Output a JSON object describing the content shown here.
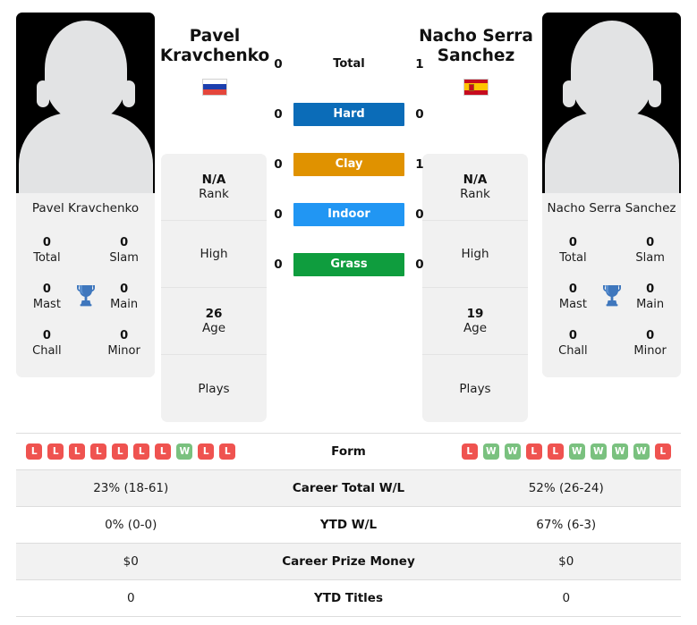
{
  "players": {
    "left": {
      "first_name": "Pavel",
      "last_name": "Kravchenko",
      "full_name": "Pavel Kravchenko",
      "country_flag": "russia-flag",
      "photo": "player-silhouette-placeholder",
      "titles": {
        "total_value": "0",
        "total_label": "Total",
        "slam_value": "0",
        "slam_label": "Slam",
        "mast_value": "0",
        "mast_label": "Mast",
        "main_value": "0",
        "main_label": "Main",
        "chall_value": "0",
        "chall_label": "Chall",
        "minor_value": "0",
        "minor_label": "Minor",
        "trophy_icon": "trophy-icon"
      },
      "info": {
        "rank_value": "N/A",
        "rank_label": "Rank",
        "high_value": "",
        "high_label": "High",
        "age_value": "26",
        "age_label": "Age",
        "plays_value": "",
        "plays_label": "Plays"
      },
      "form": [
        "L",
        "L",
        "L",
        "L",
        "L",
        "L",
        "L",
        "W",
        "L",
        "L"
      ],
      "career_total_wl": "23% (18-61)",
      "ytd_wl": "0% (0-0)",
      "career_prize_money": "$0",
      "ytd_titles": "0"
    },
    "right": {
      "first_name": "Nacho Serra",
      "last_name": "Sanchez",
      "full_name": "Nacho Serra Sanchez",
      "country_flag": "spain-flag",
      "photo": "player-silhouette-placeholder",
      "titles": {
        "total_value": "0",
        "total_label": "Total",
        "slam_value": "0",
        "slam_label": "Slam",
        "mast_value": "0",
        "mast_label": "Mast",
        "main_value": "0",
        "main_label": "Main",
        "chall_value": "0",
        "chall_label": "Chall",
        "minor_value": "0",
        "minor_label": "Minor",
        "trophy_icon": "trophy-icon"
      },
      "info": {
        "rank_value": "N/A",
        "rank_label": "Rank",
        "high_value": "",
        "high_label": "High",
        "age_value": "19",
        "age_label": "Age",
        "plays_value": "",
        "plays_label": "Plays"
      },
      "form": [
        "L",
        "W",
        "W",
        "L",
        "L",
        "W",
        "W",
        "W",
        "W",
        "L"
      ],
      "career_total_wl": "52% (26-24)",
      "ytd_wl": "67% (6-3)",
      "career_prize_money": "$0",
      "ytd_titles": "0"
    }
  },
  "head_to_head": [
    {
      "surface": "Total",
      "left_score": "0",
      "right_score": "1",
      "color": "transparent",
      "plain": true
    },
    {
      "surface": "Hard",
      "left_score": "0",
      "right_score": "0",
      "color": "#0b6cb8",
      "plain": false
    },
    {
      "surface": "Clay",
      "left_score": "0",
      "right_score": "1",
      "color": "#e09200",
      "plain": false
    },
    {
      "surface": "Indoor",
      "left_score": "0",
      "right_score": "0",
      "color": "#2196f3",
      "plain": false
    },
    {
      "surface": "Grass",
      "left_score": "0",
      "right_score": "0",
      "color": "#0f9d3e",
      "plain": false
    }
  ],
  "stats_rows": [
    {
      "label": "Form",
      "type": "form"
    },
    {
      "label": "Career Total W/L",
      "type": "text",
      "left": "23% (18-61)",
      "right": "52% (26-24)"
    },
    {
      "label": "YTD W/L",
      "type": "text",
      "left": "0% (0-0)",
      "right": "67% (6-3)"
    },
    {
      "label": "Career Prize Money",
      "type": "text",
      "left": "$0",
      "right": "$0"
    },
    {
      "label": "YTD Titles",
      "type": "text",
      "left": "0",
      "right": "0"
    }
  ],
  "colors": {
    "win_badge": "#ef5350",
    "loss_badge": "#ef5350",
    "win_green": "#7ac17f",
    "hard": "#0b6cb8",
    "clay": "#e09200",
    "indoor": "#2196f3",
    "grass": "#0f9d3e",
    "panel_bg": "#f1f1f1",
    "row_alt": "#f2f2f2"
  }
}
